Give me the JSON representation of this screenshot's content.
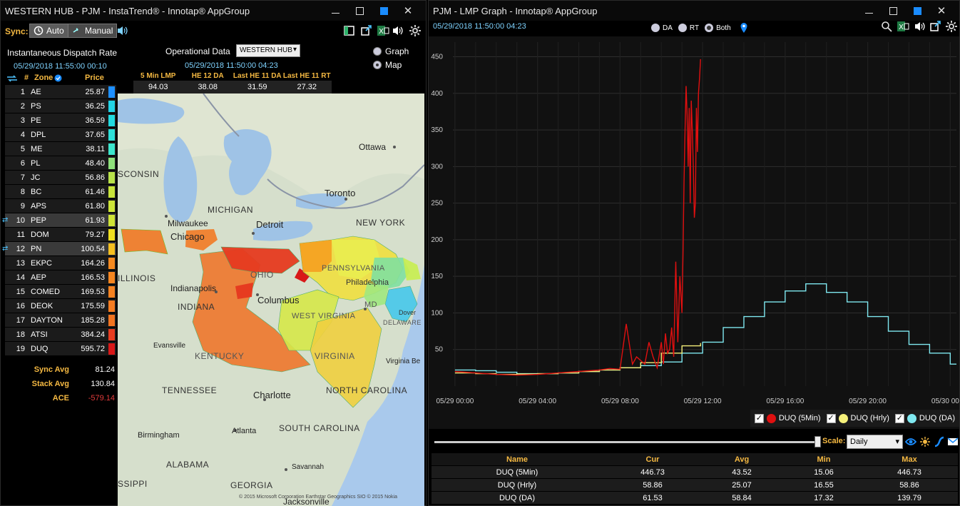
{
  "left_window": {
    "title": "WESTERN HUB - PJM - InstaTrend® - Innotap® AppGroup",
    "sync_label": "Sync:",
    "auto_label": "Auto",
    "manual_label": "Manual",
    "dispatch_title": "Instantaneous Dispatch Rate",
    "dispatch_time": "05/29/2018 11:55:00   00:10",
    "col_num": "#",
    "col_zone": "Zone",
    "col_price": "Price",
    "operational_label": "Operational Data",
    "hub_select": "WESTERN HUB",
    "op_time": "05/29/2018 11:50:00   04:23",
    "graph_option": "Graph",
    "map_option": "Map",
    "op_headers": [
      "5 Min LMP",
      "HE 12 DA",
      "Last HE 11 DA",
      "Last HE 11 RT"
    ],
    "op_values": [
      "94.03",
      "38.08",
      "31.59",
      "27.32"
    ],
    "zones": [
      {
        "num": "1",
        "name": "AE",
        "price": "25.87",
        "color": "#1e90ff"
      },
      {
        "num": "2",
        "name": "PS",
        "price": "36.25",
        "color": "#22d3e6"
      },
      {
        "num": "3",
        "name": "PE",
        "price": "36.59",
        "color": "#22dbe0"
      },
      {
        "num": "4",
        "name": "DPL",
        "price": "37.65",
        "color": "#2ee0d8"
      },
      {
        "num": "5",
        "name": "ME",
        "price": "38.11",
        "color": "#3ce6cc"
      },
      {
        "num": "6",
        "name": "PL",
        "price": "48.40",
        "color": "#8ee07a"
      },
      {
        "num": "7",
        "name": "JC",
        "price": "56.86",
        "color": "#b8e24a"
      },
      {
        "num": "8",
        "name": "BC",
        "price": "61.46",
        "color": "#c8e43a"
      },
      {
        "num": "9",
        "name": "APS",
        "price": "61.80",
        "color": "#cce438"
      },
      {
        "num": "10",
        "name": "PEP",
        "price": "61.93",
        "color": "#cfe436",
        "pinned": true
      },
      {
        "num": "11",
        "name": "DOM",
        "price": "79.27",
        "color": "#f0e020"
      },
      {
        "num": "12",
        "name": "PN",
        "price": "100.54",
        "color": "#f5c020",
        "pinned": true
      },
      {
        "num": "13",
        "name": "EKPC",
        "price": "164.26",
        "color": "#f58a20"
      },
      {
        "num": "14",
        "name": "AEP",
        "price": "166.53",
        "color": "#f58620"
      },
      {
        "num": "15",
        "name": "COMED",
        "price": "169.53",
        "color": "#f58220"
      },
      {
        "num": "16",
        "name": "DEOK",
        "price": "175.59",
        "color": "#f57c20"
      },
      {
        "num": "17",
        "name": "DAYTON",
        "price": "185.28",
        "color": "#f27420"
      },
      {
        "num": "18",
        "name": "ATSI",
        "price": "384.24",
        "color": "#e83c20"
      },
      {
        "num": "19",
        "name": "DUQ",
        "price": "595.72",
        "color": "#d81818"
      }
    ],
    "summary": [
      {
        "label": "Sync Avg",
        "value": "81.24",
        "color": "#ffffff"
      },
      {
        "label": "Stack Avg",
        "value": "130.84",
        "color": "#ffffff"
      },
      {
        "label": "ACE",
        "value": "-579.14",
        "color": "#e23b3b"
      }
    ],
    "map_labels": {
      "ottawa": "Ottawa",
      "toronto": "Toronto",
      "michigan": "MICHIGAN",
      "wisconsin": "SCONSIN",
      "milwaukee": "Milwaukee",
      "chicago": "Chicago",
      "detroit": "Detroit",
      "newyork": "NEW YORK",
      "illinois": "ILLINOIS",
      "indianapolis": "Indianapolis",
      "indiana": "INDIANA",
      "ohio": "OHIO",
      "columbus": "Columbus",
      "pennsylvania": "PENNSYLVANIA",
      "philadelphia": "Philadelphia",
      "westvirginia": "WEST VIRGINIA",
      "md": "MD",
      "dover": "Dover",
      "delaware": "DELAWARE",
      "evansville": "Evansville",
      "kentucky": "KENTUCKY",
      "virginia": "VIRGINIA",
      "virginiabeach": "Virginia Be",
      "tennessee": "TENNESSEE",
      "charlotte": "Charlotte",
      "northcarolina": "NORTH CAROLINA",
      "birmingham": "Birmingham",
      "atlanta": "Atlanta",
      "southcarolina": "SOUTH CAROLINA",
      "alabama": "ALABAMA",
      "savannah": "Savannah",
      "georgia": "GEORGIA",
      "mississippi": "SSIPPI",
      "jacksonville": "Jacksonville",
      "copyright": "© 2015 Microsoft Corporation  Earthstar Geographics SIO © 2015 Nokia"
    }
  },
  "right_window": {
    "title": "PJM - LMP Graph - Innotap® AppGroup",
    "timestamp": "05/29/2018 11:50:00   04:23",
    "radio_da": "DA",
    "radio_rt": "RT",
    "radio_both": "Both",
    "scale_label": "Scale:",
    "scale_value": "Daily",
    "legend": [
      {
        "label": "DUQ (5Min)",
        "color": "#e01010"
      },
      {
        "label": "DUQ (Hrly)",
        "color": "#f5f07a"
      },
      {
        "label": "DUQ (DA)",
        "color": "#7fe8f0"
      }
    ],
    "stats_headers": {
      "name": "Name",
      "cur": "Cur",
      "avg": "Avg",
      "min": "Min",
      "max": "Max"
    },
    "stats_rows": [
      {
        "name": "DUQ (5Min)",
        "cur": "446.73",
        "avg": "43.52",
        "min": "15.06",
        "max": "446.73"
      },
      {
        "name": "DUQ (Hrly)",
        "cur": "58.86",
        "avg": "25.07",
        "min": "16.55",
        "max": "58.86"
      },
      {
        "name": "DUQ (DA)",
        "cur": "61.53",
        "avg": "58.84",
        "min": "17.32",
        "max": "139.79"
      }
    ]
  },
  "chart_data": {
    "type": "line",
    "title": "",
    "xlabel": "",
    "ylabel": "",
    "ylim": [
      0,
      470
    ],
    "yticks": [
      50,
      100,
      150,
      200,
      250,
      300,
      350,
      400,
      450
    ],
    "xtick_labels": [
      "05/29 00:00",
      "05/29 04:00",
      "05/29 08:00",
      "05/29 12:00",
      "05/29 16:00",
      "05/29 20:00",
      "05/30 00:00"
    ],
    "xtick_hours": [
      0,
      4,
      8,
      12,
      16,
      20,
      24
    ],
    "x_range_hours": [
      -0.1,
      24.3
    ],
    "grid": true,
    "series": [
      {
        "name": "DUQ (DA)",
        "color": "#7fe8f0",
        "step": true,
        "x": [
          0,
          1,
          2,
          3,
          4,
          5,
          6,
          7,
          8,
          9,
          10,
          11,
          12,
          13,
          14,
          15,
          16,
          17,
          18,
          19,
          20,
          21,
          22,
          23,
          24
        ],
        "values": [
          22,
          21,
          19,
          17,
          17,
          18,
          20,
          22,
          25,
          28,
          33,
          45,
          60,
          80,
          95,
          115,
          130,
          139.79,
          128,
          115,
          95,
          75,
          57,
          45,
          30
        ]
      },
      {
        "name": "DUQ (Hrly)",
        "color": "#f5f07a",
        "step": true,
        "x": [
          0,
          1,
          2,
          3,
          4,
          5,
          6,
          7,
          8,
          9,
          10,
          11,
          11.9
        ],
        "values": [
          18,
          17,
          16,
          16.55,
          17,
          18,
          20,
          22,
          25,
          32,
          45,
          55,
          58.86
        ]
      },
      {
        "name": "DUQ (5Min)",
        "color": "#e01010",
        "step": false,
        "x": [
          0,
          1,
          2,
          3,
          4,
          5,
          6,
          7,
          7.5,
          8,
          8.3,
          8.6,
          8.8,
          9.0,
          9.2,
          9.4,
          9.6,
          9.8,
          10.0,
          10.1,
          10.2,
          10.3,
          10.4,
          10.5,
          10.6,
          10.7,
          10.8,
          10.9,
          11.0,
          11.05,
          11.1,
          11.15,
          11.2,
          11.25,
          11.3,
          11.35,
          11.4,
          11.45,
          11.5,
          11.55,
          11.6,
          11.65,
          11.7,
          11.75,
          11.8,
          11.85,
          11.9
        ],
        "values": [
          20,
          18,
          16,
          15.06,
          16,
          18,
          20,
          22,
          24,
          23,
          85,
          30,
          40,
          35,
          30,
          60,
          40,
          25,
          60,
          30,
          72,
          45,
          50,
          80,
          40,
          170,
          60,
          150,
          100,
          180,
          280,
          350,
          410,
          370,
          300,
          380,
          250,
          390,
          350,
          300,
          230,
          250,
          380,
          320,
          400,
          420,
          446.73
        ]
      }
    ]
  }
}
